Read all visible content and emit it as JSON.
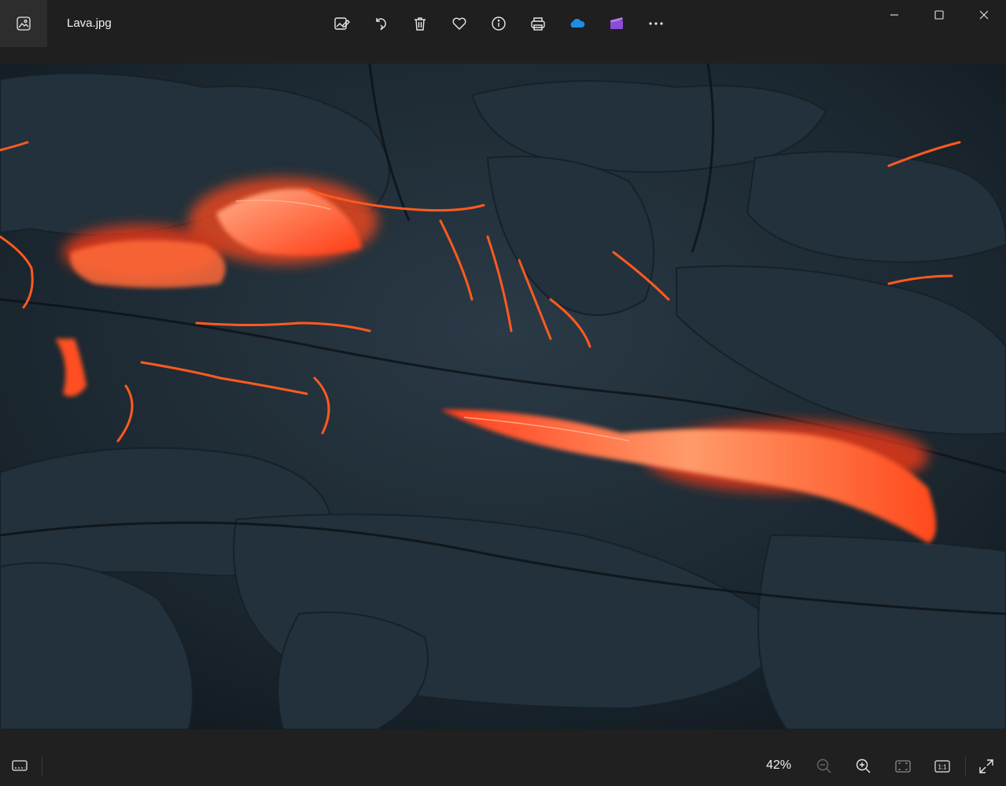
{
  "window": {
    "file_name": "Lava.jpg",
    "app_icon": "photos-app-icon"
  },
  "toolbar": {
    "buttons": [
      {
        "icon": "edit-image-icon"
      },
      {
        "icon": "rotate-icon"
      },
      {
        "icon": "delete-icon"
      },
      {
        "icon": "favorite-heart-icon"
      },
      {
        "icon": "info-icon"
      },
      {
        "icon": "print-icon"
      },
      {
        "icon": "onedrive-cloud-icon"
      },
      {
        "icon": "clipchamp-icon"
      },
      {
        "icon": "more-options-icon"
      }
    ]
  },
  "window_controls": [
    "minimize-icon",
    "maximize-icon",
    "close-icon"
  ],
  "statusbar": {
    "zoom_level": "42%",
    "actual_size_label": "1:1"
  },
  "colors": {
    "titlebar_bg": "#1f1f1f",
    "onedrive_blue": "#1a8fe0",
    "clipchamp_purple": "#8a4dd8",
    "lava_glow": "#ff5a20"
  }
}
